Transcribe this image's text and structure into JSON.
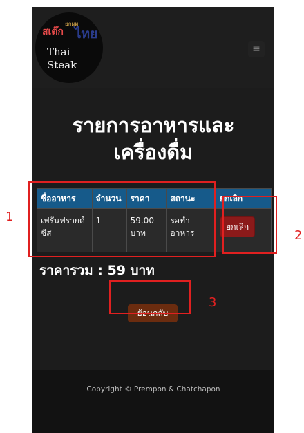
{
  "logo": {
    "sub": "ยกผม",
    "main_red": "สเต๊ก",
    "main_blue": "ไทย",
    "line1": "Thai",
    "line2": "Steak"
  },
  "navbar": {
    "menu_icon": "≡"
  },
  "page": {
    "title_line1": "รายการอาหารและ",
    "title_line2": "เครื่องดื่ม"
  },
  "table": {
    "headers": [
      "ชื่ออาหาร",
      "จำนวน",
      "ราคา",
      "สถานะ",
      "ยกเลิก"
    ],
    "rows": [
      {
        "name": "เฟรันฟรายด์ชีส",
        "qty": "1",
        "price": "59.00 บาท",
        "status": "รอทำอาหาร",
        "cancel_label": "ยกเลิก"
      }
    ]
  },
  "total": {
    "text": "ราคารวม : 59 บาท"
  },
  "back": {
    "label": "ย้อนกลับ"
  },
  "footer": {
    "copyright": "Copyright © Prempon & Chatchapon"
  },
  "annotations": {
    "n1": "1",
    "n2": "2",
    "n3": "3"
  },
  "colors": {
    "header_blue": "#165a8a",
    "cancel_red": "#8b1a1a",
    "back_brown": "#6b2c0f",
    "annotation_red": "#e02020"
  }
}
